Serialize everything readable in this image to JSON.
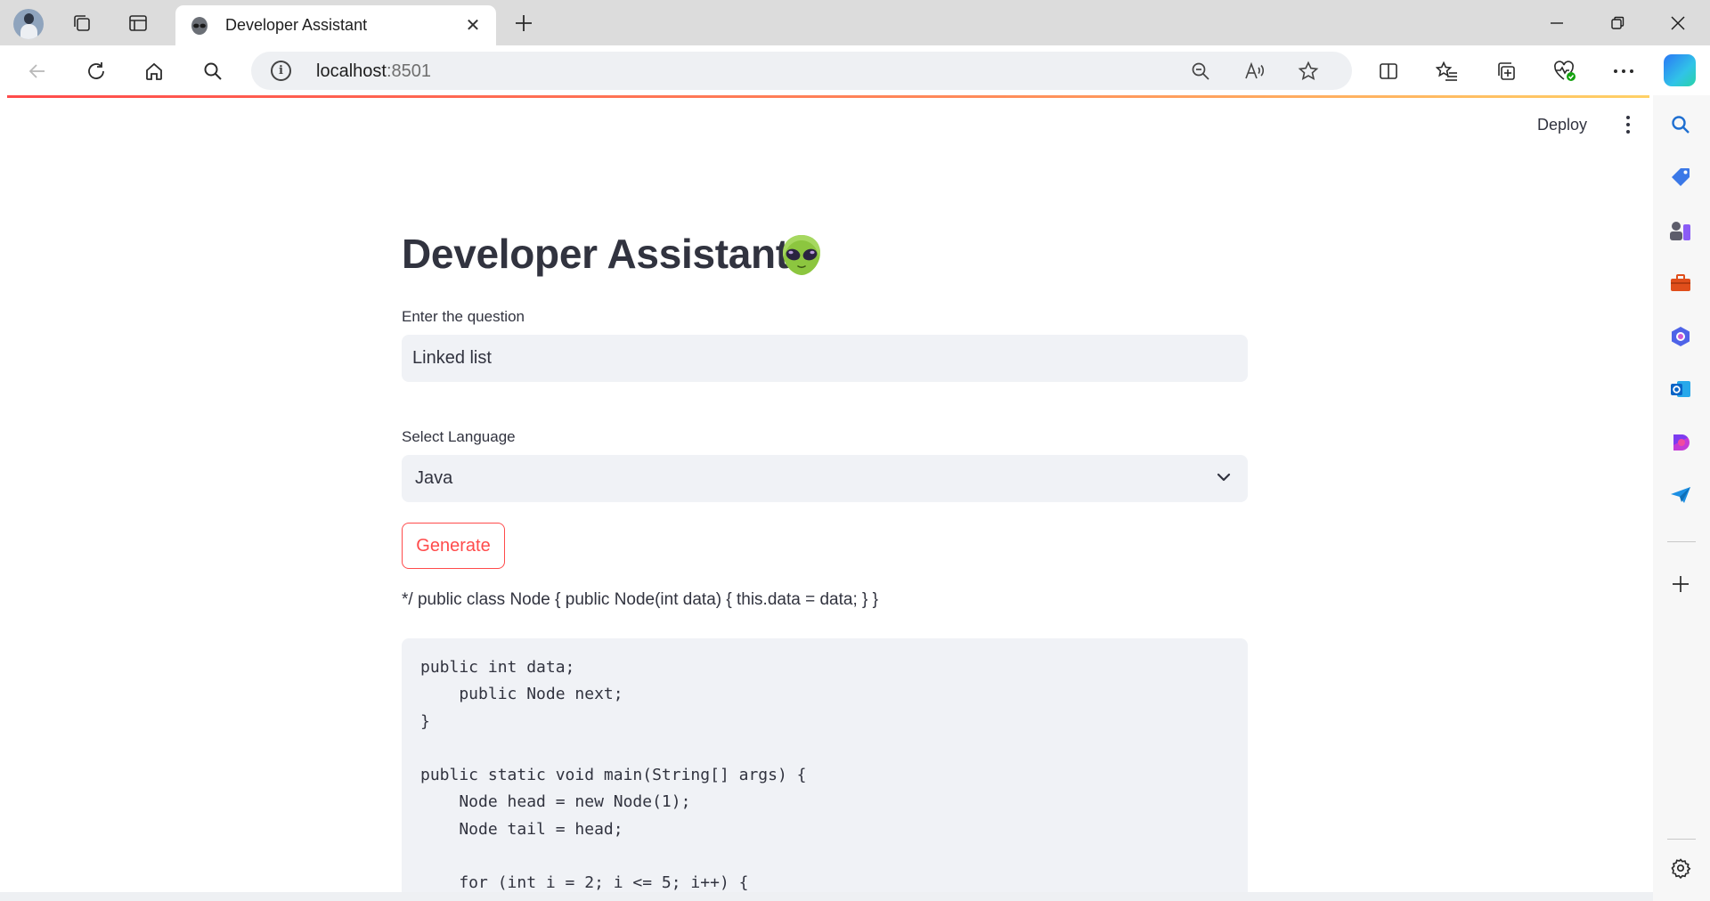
{
  "browser": {
    "tab_title": "Developer Assistant",
    "url_host": "localhost",
    "url_port": ":8501",
    "icons": {
      "workspaces": "workspaces-icon",
      "tab_actions": "tab-actions-icon",
      "back": "back-arrow-icon",
      "refresh": "refresh-icon",
      "home": "home-icon",
      "search": "search-icon",
      "zoom_out": "zoom-out-icon",
      "read_aloud": "read-aloud-icon",
      "favorite": "star-icon",
      "split_screen": "split-screen-icon",
      "favorites": "favorites-icon",
      "collections": "collections-icon",
      "performance": "heart-pulse-icon",
      "more": "more-icon",
      "copilot": "copilot-icon"
    }
  },
  "sidebar": {
    "items": [
      {
        "name": "search-icon"
      },
      {
        "name": "shopping-tag-icon"
      },
      {
        "name": "games-icon"
      },
      {
        "name": "tools-briefcase-icon"
      },
      {
        "name": "microsoft-365-icon"
      },
      {
        "name": "outlook-icon"
      },
      {
        "name": "drop-icon"
      },
      {
        "name": "send-icon"
      }
    ],
    "add_icon": "plus-icon",
    "settings_icon": "settings-gear-icon"
  },
  "app": {
    "deploy_label": "Deploy",
    "title": "Developer Assistant",
    "title_emoji": "alien-emoji-icon",
    "question_label": "Enter the question",
    "question_value": "Linked list",
    "language_label": "Select Language",
    "language_value": "Java",
    "generate_label": "Generate",
    "answer_text": "*/ public class Node { public Node(int data) { this.data = data; } }",
    "code": "public int data;\n    public Node next;\n}\n\npublic static void main(String[] args) {\n    Node head = new Node(1);\n    Node tail = head;\n\n    for (int i = 2; i <= 5; i++) {"
  },
  "colors": {
    "accent": "#ff4b4b",
    "text": "#31333f",
    "input_bg": "#f0f2f6"
  }
}
